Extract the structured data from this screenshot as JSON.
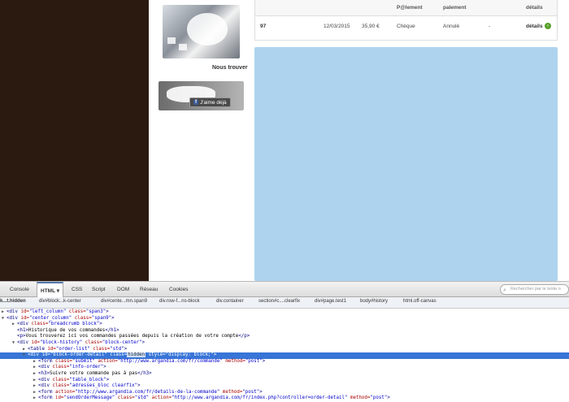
{
  "sidebar": {
    "section_label": "Nous trouver",
    "facebook_like": "J'aime déjà",
    "facebook_icon": "f"
  },
  "orders_table": {
    "headers": [
      "P@lement",
      "palement",
      "détails"
    ],
    "row": {
      "ref": "97",
      "date": "12/03/2015",
      "amount": "35,90 €",
      "payment": "Chèque",
      "status": "Annulé",
      "dash": "-",
      "details": "détails"
    }
  },
  "devtools": {
    "tabs": [
      "Console",
      "HTML",
      "CSS",
      "Script",
      "DOM",
      "Réseau",
      "Cookies"
    ],
    "active_tab": "HTML",
    "search_placeholder": "Rechercher par le texte o",
    "breadcrumb": [
      "k...t.hidden",
      "div#block...k-center",
      "div#cente...mn.span9",
      "div.row-f...ns-block",
      "div.container",
      "section#c....clearfix",
      "div#page.test1",
      "body#history",
      "html.off-canvas"
    ],
    "tree": [
      {
        "indent": 0,
        "tw": "▶",
        "parts": [
          [
            "tag",
            "<div "
          ],
          [
            "attr",
            "id="
          ],
          [
            "val",
            "\"left_column\""
          ],
          [
            "attr",
            " class="
          ],
          [
            "val",
            "\"span3\""
          ],
          [
            "tag",
            ">"
          ]
        ]
      },
      {
        "indent": 0,
        "tw": "▼",
        "parts": [
          [
            "tag",
            "<div "
          ],
          [
            "attr",
            "id="
          ],
          [
            "val",
            "\"center_column\""
          ],
          [
            "attr",
            " class="
          ],
          [
            "val",
            "\"span9\""
          ],
          [
            "tag",
            ">"
          ]
        ]
      },
      {
        "indent": 1,
        "tw": "▶",
        "parts": [
          [
            "tag",
            "<div "
          ],
          [
            "attr",
            "class="
          ],
          [
            "val",
            "\"breadcrumb block\""
          ],
          [
            "tag",
            ">"
          ]
        ]
      },
      {
        "indent": 1,
        "tw": "",
        "parts": [
          [
            "tag",
            "<h1>"
          ],
          [
            "txt",
            "Historique de vos commandes"
          ],
          [
            "tag",
            "</h1>"
          ]
        ]
      },
      {
        "indent": 1,
        "tw": "",
        "parts": [
          [
            "tag",
            "<p>"
          ],
          [
            "txt",
            "Vous trouverez ici vos commandes passées depuis la création de votre compte"
          ],
          [
            "tag",
            "</p>"
          ]
        ]
      },
      {
        "indent": 1,
        "tw": "▼",
        "parts": [
          [
            "tag",
            "<div "
          ],
          [
            "attr",
            "id="
          ],
          [
            "val",
            "\"block-history\""
          ],
          [
            "attr",
            " class="
          ],
          [
            "val",
            "\"block-center\""
          ],
          [
            "tag",
            ">"
          ]
        ]
      },
      {
        "indent": 2,
        "tw": "▶",
        "parts": [
          [
            "tag",
            "<table "
          ],
          [
            "attr",
            "id="
          ],
          [
            "val",
            "\"order-list\""
          ],
          [
            "attr",
            " class="
          ],
          [
            "val",
            "\"std\""
          ],
          [
            "tag",
            ">"
          ]
        ]
      },
      {
        "indent": 2,
        "tw": "▼",
        "sel": true,
        "parts": [
          [
            "tag",
            "<div "
          ],
          [
            "attr",
            "id="
          ],
          [
            "val",
            "\"block-order-detail\""
          ],
          [
            "attr",
            " class="
          ],
          [
            "hl",
            "hidden"
          ],
          [
            "attr",
            " style="
          ],
          [
            "val",
            "\"display: block;\""
          ],
          [
            "tag",
            ">"
          ]
        ]
      },
      {
        "indent": 3,
        "tw": "▶",
        "parts": [
          [
            "tag",
            "<form "
          ],
          [
            "attr",
            "class="
          ],
          [
            "val",
            "\"submit\""
          ],
          [
            "attr",
            " action="
          ],
          [
            "val",
            "\"http://www.argandia.com/fr/commande\""
          ],
          [
            "attr",
            " method="
          ],
          [
            "val",
            "\"post\""
          ],
          [
            "tag",
            ">"
          ]
        ]
      },
      {
        "indent": 3,
        "tw": "▶",
        "parts": [
          [
            "tag",
            "<div "
          ],
          [
            "attr",
            "class="
          ],
          [
            "val",
            "\"info-order\""
          ],
          [
            "tag",
            ">"
          ]
        ]
      },
      {
        "indent": 3,
        "tw": "▶",
        "parts": [
          [
            "tag",
            "<h3>"
          ],
          [
            "txt",
            "Suivre votre commande pas à pas"
          ],
          [
            "tag",
            "</h3>"
          ]
        ]
      },
      {
        "indent": 3,
        "tw": "▶",
        "parts": [
          [
            "tag",
            "<div "
          ],
          [
            "attr",
            "class="
          ],
          [
            "val",
            "\"table_block\""
          ],
          [
            "tag",
            ">"
          ]
        ]
      },
      {
        "indent": 3,
        "tw": "▶",
        "parts": [
          [
            "tag",
            "<div "
          ],
          [
            "attr",
            "class="
          ],
          [
            "val",
            "\"adresses_bloc clearfix\""
          ],
          [
            "tag",
            ">"
          ]
        ]
      },
      {
        "indent": 3,
        "tw": "▶",
        "parts": [
          [
            "tag",
            "<form "
          ],
          [
            "attr",
            "action="
          ],
          [
            "val",
            "\"http://www.argandia.com/fr/details-de-la-commande\""
          ],
          [
            "attr",
            " method="
          ],
          [
            "val",
            "\"post\""
          ],
          [
            "tag",
            ">"
          ]
        ]
      },
      {
        "indent": 3,
        "tw": "▶",
        "parts": [
          [
            "tag",
            "<form "
          ],
          [
            "attr",
            "id="
          ],
          [
            "val",
            "\"sendOrderMessage\""
          ],
          [
            "attr",
            " class="
          ],
          [
            "val",
            "\"std\""
          ],
          [
            "attr",
            " action="
          ],
          [
            "val",
            "\"http://www.argandia.com/fr/index.php?controller=order-detail\""
          ],
          [
            "attr",
            " method="
          ],
          [
            "val",
            "\"post\""
          ],
          [
            "tag",
            ">"
          ]
        ]
      }
    ]
  },
  "colors": {
    "left_background": "#2a1a10",
    "highlight_overlay": "#aed3ef",
    "selection": "#3875d7"
  }
}
